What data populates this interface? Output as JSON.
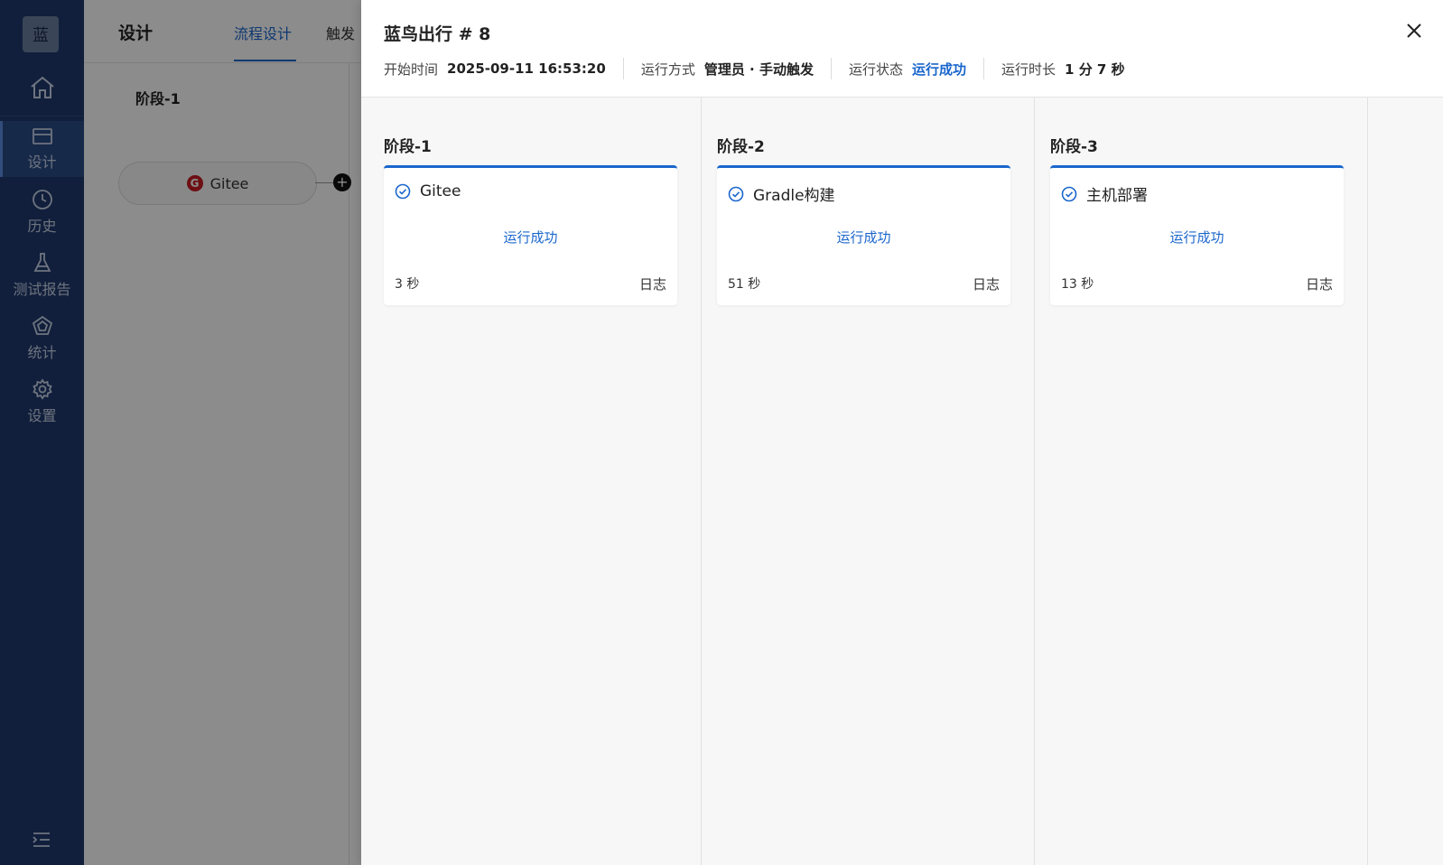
{
  "sidebar": {
    "logo_text": "蓝",
    "items": [
      {
        "label": "设计",
        "icon": "design-icon"
      },
      {
        "label": "历史",
        "icon": "history-clock-icon"
      },
      {
        "label": "测试报告",
        "icon": "flask-icon"
      },
      {
        "label": "统计",
        "icon": "statistics-icon"
      },
      {
        "label": "设置",
        "icon": "gear-icon"
      }
    ],
    "active": "设计"
  },
  "background": {
    "title": "设计",
    "tabs": [
      "流程设计",
      "触发"
    ],
    "active_tab": "流程设计",
    "stage_title": "阶段-1",
    "node_label": "Gitee",
    "node_logo_letter": "G",
    "plus_symbol": "+"
  },
  "drawer": {
    "title": "蓝鸟出行 # 8",
    "meta": {
      "start_label": "开始时间",
      "start_value": "2025-09-11 16:53:20",
      "mode_label": "运行方式",
      "mode_value": "管理员 · 手动触发",
      "status_label": "运行状态",
      "status_value": "运行成功",
      "duration_label": "运行时长",
      "duration_value": "1 分 7 秒"
    },
    "stages": [
      {
        "title": "阶段-1",
        "job": {
          "name": "Gitee",
          "status": "运行成功",
          "duration": "3 秒",
          "log": "日志"
        }
      },
      {
        "title": "阶段-2",
        "job": {
          "name": "Gradle构建",
          "status": "运行成功",
          "duration": "51 秒",
          "log": "日志"
        }
      },
      {
        "title": "阶段-3",
        "job": {
          "name": "主机部署",
          "status": "运行成功",
          "duration": "13 秒",
          "log": "日志"
        }
      }
    ]
  },
  "colors": {
    "sidebar_bg": "#1f3a6e",
    "accent": "#1a66cc",
    "gitee_red": "#c71d23"
  }
}
